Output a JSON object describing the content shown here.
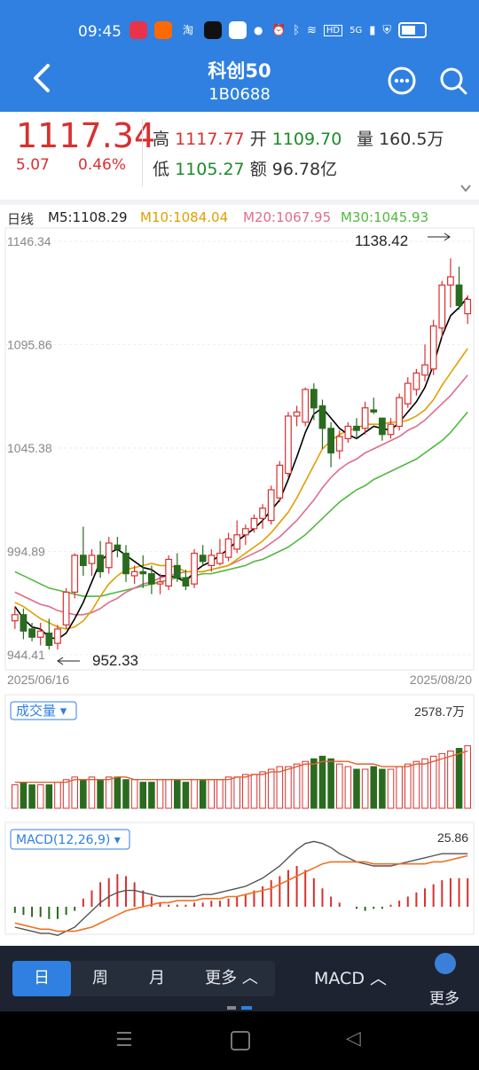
{
  "status": {
    "time": "09:45",
    "network": "5G"
  },
  "header": {
    "title": "科创50",
    "code": "1B0688"
  },
  "quote": {
    "price": "1117.34",
    "change": "5.07",
    "change_pct": "0.46%",
    "high_label": "高",
    "high": "1117.77",
    "open_label": "开",
    "open": "1109.70",
    "vol_label": "量",
    "volume": "160.5万",
    "low_label": "低",
    "low": "1105.27",
    "amt_label": "额",
    "amount": "96.78亿"
  },
  "ma": {
    "period": "日线",
    "m5": "M5:1108.29",
    "m10": "M10:1084.04",
    "m20": "M20:1067.95",
    "m30": "M30:1045.93"
  },
  "chart_data": {
    "type": "candlestick",
    "y_ticks": [
      "1146.34",
      "1095.86",
      "1045.38",
      "994.89",
      "944.41"
    ],
    "x_start": "2025/06/16",
    "x_end": "2025/08/20",
    "max_label": "1138.42",
    "min_label": "952.33",
    "colors": {
      "up": "#d83030",
      "down": "#2a6b1f",
      "ma5": "#000000",
      "ma10": "#e0a000",
      "ma20": "#e06c8c",
      "ma30": "#52b840"
    },
    "candles": [
      {
        "o": 961,
        "c": 964,
        "h": 968,
        "l": 957
      },
      {
        "o": 964,
        "c": 956,
        "h": 967,
        "l": 952
      },
      {
        "o": 957,
        "c": 953,
        "h": 960,
        "l": 951
      },
      {
        "o": 953,
        "c": 956,
        "h": 960,
        "l": 949
      },
      {
        "o": 955,
        "c": 949,
        "h": 962,
        "l": 947
      },
      {
        "o": 950,
        "c": 957,
        "h": 959,
        "l": 947
      },
      {
        "o": 959,
        "c": 975,
        "h": 977,
        "l": 957
      },
      {
        "o": 975,
        "c": 993,
        "h": 994,
        "l": 972
      },
      {
        "o": 993,
        "c": 988,
        "h": 1007,
        "l": 983
      },
      {
        "o": 989,
        "c": 993,
        "h": 996,
        "l": 983
      },
      {
        "o": 993,
        "c": 985,
        "h": 1000,
        "l": 982
      },
      {
        "o": 987,
        "c": 999,
        "h": 1002,
        "l": 984
      },
      {
        "o": 998,
        "c": 996,
        "h": 1002,
        "l": 992
      },
      {
        "o": 994,
        "c": 984,
        "h": 998,
        "l": 980
      },
      {
        "o": 983,
        "c": 985,
        "h": 988,
        "l": 979
      },
      {
        "o": 985,
        "c": 984,
        "h": 993,
        "l": 977
      },
      {
        "o": 984,
        "c": 979,
        "h": 988,
        "l": 974
      },
      {
        "o": 979,
        "c": 980,
        "h": 984,
        "l": 974
      },
      {
        "o": 978,
        "c": 991,
        "h": 993,
        "l": 976
      },
      {
        "o": 988,
        "c": 982,
        "h": 994,
        "l": 980
      },
      {
        "o": 982,
        "c": 978,
        "h": 986,
        "l": 976
      },
      {
        "o": 979,
        "c": 994,
        "h": 996,
        "l": 977
      },
      {
        "o": 993,
        "c": 990,
        "h": 998,
        "l": 988
      },
      {
        "o": 988,
        "c": 993,
        "h": 996,
        "l": 985
      },
      {
        "o": 989,
        "c": 994,
        "h": 1001,
        "l": 988
      },
      {
        "o": 992,
        "c": 1001,
        "h": 1004,
        "l": 990
      },
      {
        "o": 996,
        "c": 1003,
        "h": 1010,
        "l": 994
      },
      {
        "o": 1003,
        "c": 1006,
        "h": 1008,
        "l": 998
      },
      {
        "o": 1006,
        "c": 1011,
        "h": 1013,
        "l": 1004
      },
      {
        "o": 1011,
        "c": 1016,
        "h": 1018,
        "l": 1006
      },
      {
        "o": 1010,
        "c": 1025,
        "h": 1027,
        "l": 1008
      },
      {
        "o": 1021,
        "c": 1037,
        "h": 1039,
        "l": 1019
      },
      {
        "o": 1033,
        "c": 1061,
        "h": 1063,
        "l": 1031
      },
      {
        "o": 1061,
        "c": 1063,
        "h": 1066,
        "l": 1056
      },
      {
        "o": 1058,
        "c": 1074,
        "h": 1075,
        "l": 1056
      },
      {
        "o": 1074,
        "c": 1065,
        "h": 1077,
        "l": 1059
      },
      {
        "o": 1066,
        "c": 1055,
        "h": 1069,
        "l": 1045
      },
      {
        "o": 1055,
        "c": 1043,
        "h": 1058,
        "l": 1036
      },
      {
        "o": 1044,
        "c": 1051,
        "h": 1054,
        "l": 1040
      },
      {
        "o": 1050,
        "c": 1056,
        "h": 1058,
        "l": 1048
      },
      {
        "o": 1056,
        "c": 1054,
        "h": 1060,
        "l": 1050
      },
      {
        "o": 1055,
        "c": 1065,
        "h": 1068,
        "l": 1052
      },
      {
        "o": 1064,
        "c": 1063,
        "h": 1070,
        "l": 1062
      },
      {
        "o": 1060,
        "c": 1052,
        "h": 1060,
        "l": 1049
      },
      {
        "o": 1052,
        "c": 1057,
        "h": 1060,
        "l": 1050
      },
      {
        "o": 1056,
        "c": 1070,
        "h": 1072,
        "l": 1054
      },
      {
        "o": 1067,
        "c": 1077,
        "h": 1080,
        "l": 1065
      },
      {
        "o": 1074,
        "c": 1082,
        "h": 1084,
        "l": 1071
      },
      {
        "o": 1081,
        "c": 1086,
        "h": 1096,
        "l": 1078
      },
      {
        "o": 1084,
        "c": 1105,
        "h": 1108,
        "l": 1081
      },
      {
        "o": 1104,
        "c": 1125,
        "h": 1127,
        "l": 1099
      },
      {
        "o": 1125,
        "c": 1129,
        "h": 1138,
        "l": 1114
      },
      {
        "o": 1125,
        "c": 1115,
        "h": 1134,
        "l": 1113
      },
      {
        "o": 1111,
        "c": 1118,
        "h": 1120,
        "l": 1106
      }
    ],
    "ma5": [
      968,
      962,
      958,
      957,
      953,
      952,
      955,
      962,
      970,
      980,
      990,
      994,
      996,
      993,
      990,
      987,
      986,
      983,
      983,
      982,
      980,
      985,
      988,
      990,
      993,
      996,
      1000,
      1003,
      1006,
      1010,
      1015,
      1020,
      1030,
      1041,
      1053,
      1062,
      1065,
      1060,
      1055,
      1052,
      1050,
      1053,
      1056,
      1055,
      1054,
      1058,
      1063,
      1068,
      1075,
      1086,
      1100,
      1110,
      1114,
      1119
    ],
    "ma10": [
      970,
      968,
      965,
      962,
      960,
      958,
      957,
      958,
      961,
      966,
      973,
      979,
      983,
      986,
      987,
      988,
      989,
      988,
      988,
      987,
      985,
      985,
      985,
      986,
      987,
      988,
      991,
      994,
      997,
      1000,
      1004,
      1009,
      1014,
      1021,
      1029,
      1037,
      1045,
      1049,
      1052,
      1054,
      1055,
      1057,
      1057,
      1057,
      1058,
      1058,
      1059,
      1061,
      1064,
      1069,
      1076,
      1082,
      1088,
      1094
    ],
    "ma20": [
      975,
      973,
      971,
      969,
      968,
      966,
      965,
      964,
      964,
      965,
      967,
      970,
      972,
      975,
      977,
      979,
      980,
      982,
      983,
      984,
      985,
      985,
      985,
      986,
      987,
      988,
      990,
      992,
      994,
      996,
      999,
      1002,
      1006,
      1010,
      1015,
      1020,
      1026,
      1031,
      1035,
      1038,
      1040,
      1043,
      1045,
      1047,
      1049,
      1051,
      1054,
      1056,
      1059,
      1063,
      1067,
      1071,
      1076,
      1081
    ],
    "ma30": [
      985,
      983,
      981,
      979,
      977,
      976,
      975,
      974,
      973,
      973,
      973,
      974,
      975,
      976,
      977,
      978,
      979,
      980,
      981,
      982,
      982,
      983,
      984,
      984,
      985,
      986,
      987,
      988,
      990,
      991,
      993,
      995,
      997,
      1000,
      1003,
      1007,
      1011,
      1015,
      1019,
      1022,
      1025,
      1027,
      1030,
      1032,
      1034,
      1036,
      1038,
      1040,
      1043,
      1046,
      1049,
      1053,
      1058,
      1063
    ],
    "volume": {
      "label": "成交量",
      "max_label": "2578.7万",
      "values": [
        9,
        10,
        9,
        9,
        9,
        10,
        11,
        12,
        11,
        12,
        11,
        12,
        12,
        11,
        11,
        10,
        10,
        11,
        11,
        11,
        10,
        11,
        11,
        11,
        11,
        12,
        12,
        13,
        13,
        14,
        15,
        16,
        16,
        17,
        18,
        19,
        20,
        19,
        17,
        16,
        15,
        15,
        16,
        15,
        15,
        16,
        17,
        18,
        19,
        20,
        21,
        22,
        23,
        24
      ],
      "ma": [
        10,
        10,
        10,
        10,
        10,
        10,
        10,
        11,
        11,
        11,
        11,
        11,
        12,
        12,
        11,
        11,
        11,
        11,
        11,
        11,
        11,
        11,
        11,
        11,
        11,
        11,
        12,
        12,
        13,
        13,
        14,
        14,
        15,
        16,
        17,
        17,
        18,
        18,
        18,
        18,
        17,
        17,
        17,
        16,
        16,
        16,
        16,
        17,
        17,
        18,
        19,
        20,
        21,
        22
      ]
    },
    "macd": {
      "label": "MACD(12,26,9)",
      "value_label": "25.86",
      "bars": [
        -3,
        -4,
        -5,
        -5,
        -6,
        -6,
        -4,
        -2,
        4,
        8,
        12,
        14,
        16,
        15,
        12,
        8,
        5,
        2,
        1,
        1,
        1,
        2,
        2,
        3,
        3,
        4,
        5,
        6,
        8,
        10,
        13,
        15,
        18,
        20,
        18,
        14,
        9,
        5,
        2,
        0,
        -1,
        -2,
        -1,
        -1,
        1,
        3,
        5,
        7,
        9,
        11,
        13,
        14,
        14,
        14
      ],
      "dif": [
        -10,
        -11,
        -12,
        -13,
        -13,
        -14,
        -12,
        -10,
        -6,
        -2,
        2,
        5,
        7,
        8,
        8,
        7,
        6,
        5,
        5,
        5,
        5,
        5,
        6,
        6,
        7,
        8,
        9,
        10,
        12,
        14,
        17,
        20,
        24,
        28,
        31,
        32,
        31,
        29,
        26,
        24,
        22,
        21,
        20,
        20,
        20,
        21,
        22,
        23,
        24,
        25,
        26,
        26,
        26,
        26
      ],
      "dea": [
        -8,
        -9,
        -10,
        -11,
        -11,
        -12,
        -12,
        -12,
        -11,
        -10,
        -8,
        -6,
        -4,
        -2,
        -1,
        0,
        1,
        2,
        2,
        3,
        3,
        3,
        4,
        4,
        4,
        5,
        5,
        6,
        7,
        8,
        9,
        11,
        13,
        15,
        17,
        19,
        21,
        22,
        22,
        22,
        22,
        22,
        21,
        21,
        21,
        21,
        21,
        21,
        21,
        22,
        22,
        23,
        24,
        25
      ]
    }
  },
  "bottom": {
    "tabs": [
      "日",
      "周",
      "月",
      "更多 ︿"
    ],
    "indicator": "MACD ︿",
    "more": "更多"
  }
}
